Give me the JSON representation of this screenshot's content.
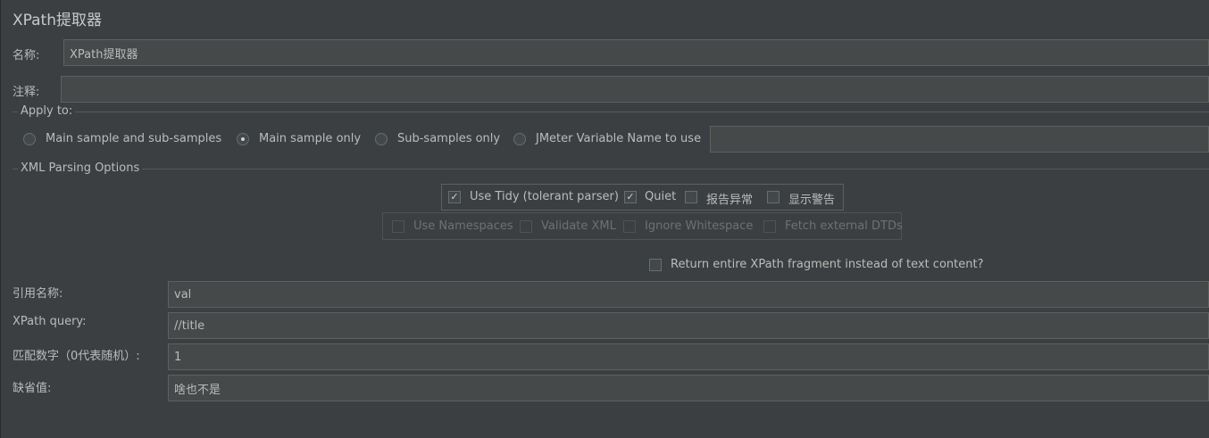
{
  "title": "XPath提取器",
  "name_label": "名称:",
  "name_value": "XPath提取器",
  "comment_label": "注释:",
  "comment_value": "",
  "apply_to": {
    "title": "Apply to:",
    "options": [
      {
        "label": "Main sample and sub-samples",
        "selected": false
      },
      {
        "label": "Main sample only",
        "selected": true
      },
      {
        "label": "Sub-samples only",
        "selected": false
      },
      {
        "label": "JMeter Variable Name to use",
        "selected": false
      }
    ],
    "variable_value": ""
  },
  "xml_parsing": {
    "title": "XML Parsing Options",
    "row1": [
      {
        "label": "Use Tidy (tolerant parser)",
        "checked": true
      },
      {
        "label": "Quiet",
        "checked": true
      },
      {
        "label": "报告异常",
        "checked": false
      },
      {
        "label": "显示警告",
        "checked": false
      }
    ],
    "row2": [
      {
        "label": "Use Namespaces",
        "checked": false,
        "disabled": true
      },
      {
        "label": "Validate XML",
        "checked": false,
        "disabled": true
      },
      {
        "label": "Ignore Whitespace",
        "checked": false,
        "disabled": true
      },
      {
        "label": "Fetch external DTDs",
        "checked": false,
        "disabled": true
      }
    ],
    "return_fragment": {
      "label": "Return entire XPath fragment instead of text content?",
      "checked": false
    }
  },
  "fields": {
    "ref_name": {
      "label": "引用名称:",
      "value": "val"
    },
    "xpath_query": {
      "label": "XPath query:",
      "value": "//title"
    },
    "match_no": {
      "label": "匹配数字（0代表随机）:",
      "value": "1"
    },
    "default_value": {
      "label": "缺省值:",
      "value": "啥也不是"
    }
  },
  "check_glyph": "✓",
  "colors": {
    "background": "#3c3f41",
    "field": "#45494a",
    "border": "#5e6060",
    "text": "#bbbbbb"
  }
}
